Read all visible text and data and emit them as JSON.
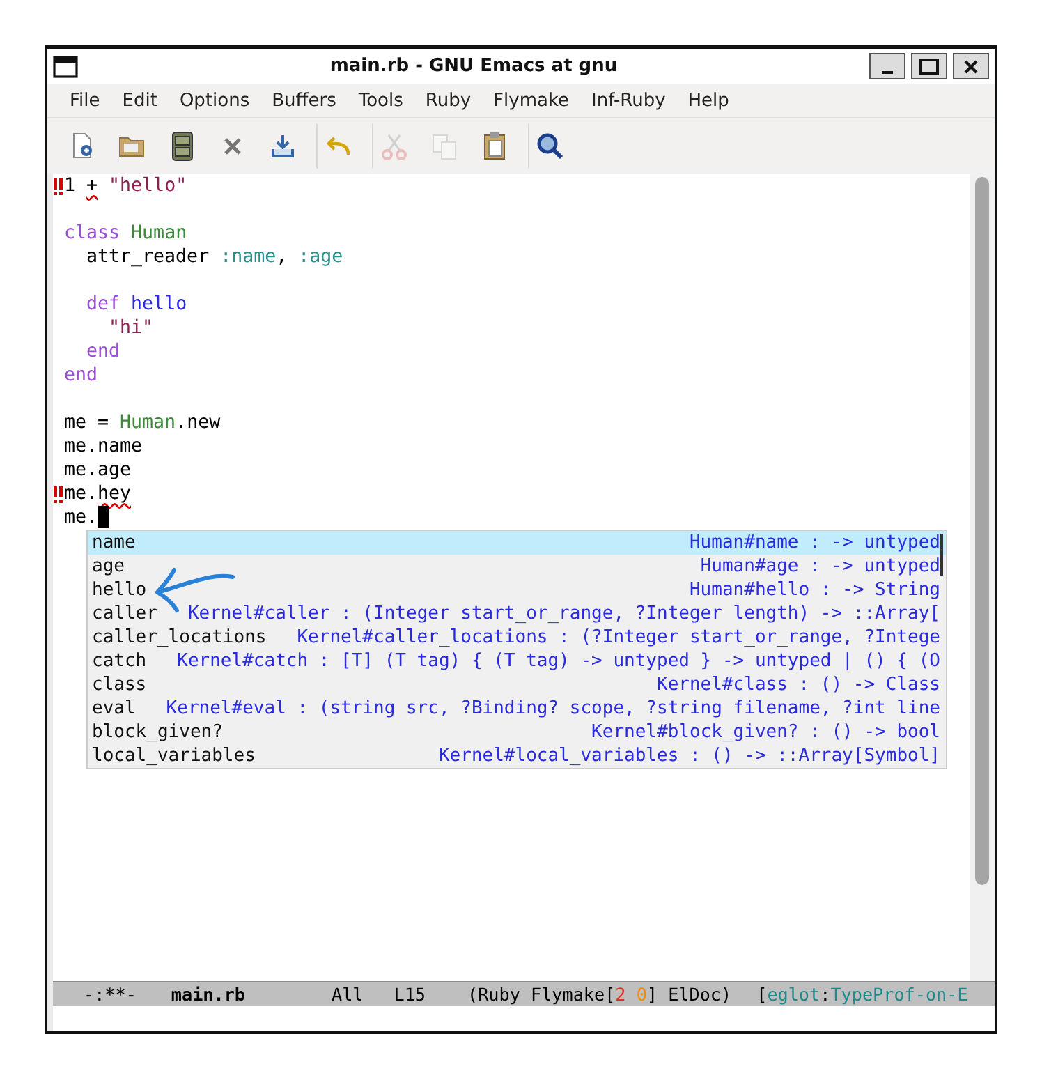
{
  "window": {
    "title": "main.rb - GNU Emacs at gnu"
  },
  "menu": [
    "File",
    "Edit",
    "Options",
    "Buffers",
    "Tools",
    "Ruby",
    "Flymake",
    "Inf-Ruby",
    "Help"
  ],
  "toolbar": [
    [
      {
        "disabled": false
      },
      {
        "disabled": false
      },
      {
        "disabled": false
      },
      {
        "disabled": false
      },
      {
        "disabled": false
      }
    ],
    [
      {
        "disabled": false
      }
    ],
    [
      {
        "disabled": true
      },
      {
        "disabled": true
      },
      {
        "disabled": false
      }
    ],
    [
      {
        "disabled": false
      }
    ]
  ],
  "editor": {
    "lines": [
      {
        "error_flag": true,
        "cursor": false,
        "tokens": [
          {
            "text": "1 ",
            "kind": "plain",
            "error": false
          },
          {
            "text": "+",
            "kind": "plain",
            "error": true
          },
          {
            "text": " \"hello\"",
            "kind": "string",
            "error": false
          }
        ]
      },
      {
        "error_flag": false,
        "cursor": false
      },
      {
        "error_flag": false,
        "cursor": false,
        "tokens": [
          {
            "text": "class ",
            "kind": "keyword",
            "error": false
          },
          {
            "text": "Human",
            "kind": "type",
            "error": false
          }
        ]
      },
      {
        "error_flag": false,
        "cursor": false,
        "tokens": [
          {
            "text": "  attr_reader ",
            "kind": "plain",
            "error": false
          },
          {
            "text": ":name",
            "kind": "symbol",
            "error": false
          },
          {
            "text": ", ",
            "kind": "plain",
            "error": false
          },
          {
            "text": ":age",
            "kind": "symbol",
            "error": false
          }
        ]
      },
      {
        "error_flag": false,
        "cursor": false
      },
      {
        "error_flag": false,
        "cursor": false,
        "tokens": [
          {
            "text": "  def ",
            "kind": "keyword",
            "error": false
          },
          {
            "text": "hello",
            "kind": "function",
            "error": false
          }
        ]
      },
      {
        "error_flag": false,
        "cursor": false,
        "tokens": [
          {
            "text": "    \"hi\"",
            "kind": "string",
            "error": false
          }
        ]
      },
      {
        "error_flag": false,
        "cursor": false,
        "tokens": [
          {
            "text": "  end",
            "kind": "keyword",
            "error": false
          }
        ]
      },
      {
        "error_flag": false,
        "cursor": false,
        "tokens": [
          {
            "text": "end",
            "kind": "keyword",
            "error": false
          }
        ]
      },
      {
        "error_flag": false,
        "cursor": false
      },
      {
        "error_flag": false,
        "cursor": false,
        "tokens": [
          {
            "text": "me = ",
            "kind": "plain",
            "error": false
          },
          {
            "text": "Human",
            "kind": "type",
            "error": false
          },
          {
            "text": ".new",
            "kind": "plain",
            "error": false
          }
        ]
      },
      {
        "error_flag": false,
        "cursor": false,
        "tokens": [
          {
            "text": "me.name",
            "kind": "plain",
            "error": false
          }
        ]
      },
      {
        "error_flag": false,
        "cursor": false,
        "tokens": [
          {
            "text": "me.age",
            "kind": "plain",
            "error": false
          }
        ]
      },
      {
        "error_flag": true,
        "cursor": false,
        "tokens": [
          {
            "text": "me.",
            "kind": "plain",
            "error": false
          },
          {
            "text": "hey",
            "kind": "plain",
            "error": true
          }
        ]
      },
      {
        "error_flag": false,
        "cursor": true,
        "tokens": [
          {
            "text": "me.",
            "kind": "plain",
            "error": false
          }
        ]
      }
    ]
  },
  "completion": [
    {
      "label": "name",
      "annotation": "Human#name : -> untyped",
      "selected": true
    },
    {
      "label": "age",
      "annotation": "Human#age : -> untyped",
      "selected": false
    },
    {
      "label": "hello",
      "annotation": "Human#hello : -> String",
      "selected": false
    },
    {
      "label": "caller",
      "annotation": "Kernel#caller : (Integer start_or_range, ?Integer length) -> ::Array[",
      "selected": false
    },
    {
      "label": "caller_locations",
      "annotation": "Kernel#caller_locations : (?Integer start_or_range, ?Intege",
      "selected": false
    },
    {
      "label": "catch",
      "annotation": "Kernel#catch : [T] (T tag) { (T tag) -> untyped } -> untyped | () { (O",
      "selected": false
    },
    {
      "label": "class",
      "annotation": "Kernel#class : () -> Class",
      "selected": false
    },
    {
      "label": "eval",
      "annotation": "Kernel#eval : (string src, ?Binding? scope, ?string filename, ?int line",
      "selected": false
    },
    {
      "label": "block_given?",
      "annotation": "Kernel#block_given? : () -> bool",
      "selected": false
    },
    {
      "label": "local_variables",
      "annotation": "Kernel#local_variables : () -> ::Array[Symbol]",
      "selected": false
    }
  ],
  "mode_line": [
    {
      "parts": [
        {
          "text": "-:**-",
          "kind": "plain"
        }
      ]
    },
    {
      "parts": [
        {
          "text": "main.rb",
          "kind": "buffer"
        }
      ]
    },
    {
      "parts": [
        {
          "text": "All",
          "kind": "plain"
        }
      ]
    },
    {
      "parts": [
        {
          "text": "L15",
          "kind": "plain"
        }
      ]
    },
    {
      "parts": [
        {
          "text": "(Ruby Flymake[",
          "kind": "plain"
        },
        {
          "text": "2",
          "kind": "error"
        },
        {
          "text": " 0",
          "kind": "warning"
        },
        {
          "text": "] ElDoc)",
          "kind": "plain"
        }
      ]
    },
    {
      "parts": [
        {
          "text": "[",
          "kind": "plain"
        },
        {
          "text": "eglot",
          "kind": "server"
        },
        {
          "text": ":",
          "kind": "plain"
        },
        {
          "text": "TypeProf-on-E",
          "kind": "server"
        }
      ]
    }
  ]
}
